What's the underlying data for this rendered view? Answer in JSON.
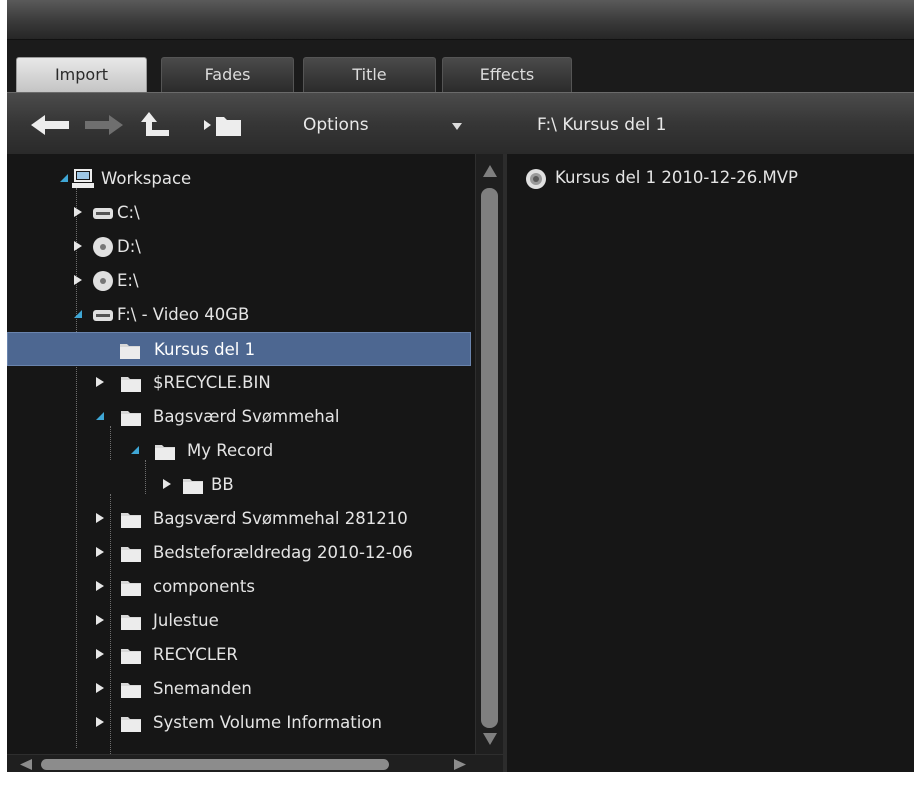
{
  "tabs": [
    {
      "label": "Import",
      "active": true
    },
    {
      "label": "Fades",
      "active": false
    },
    {
      "label": "Title",
      "active": false
    },
    {
      "label": "Effects",
      "active": false
    }
  ],
  "toolbar": {
    "back_icon": "arrow-left-icon",
    "forward_icon": "arrow-right-icon",
    "up_icon": "folder-up-icon",
    "browse_icon": "open-folder-icon",
    "options_label": "Options",
    "current_path": "F:\\ Kursus del 1"
  },
  "tree": {
    "items": [
      {
        "label": "Workspace",
        "icon": "computer-icon",
        "expander": "expanded"
      },
      {
        "label": "C:\\",
        "icon": "hard-drive-icon",
        "expander": "collapsed"
      },
      {
        "label": "D:\\",
        "icon": "disc-icon",
        "expander": "collapsed"
      },
      {
        "label": "E:\\",
        "icon": "disc-icon",
        "expander": "collapsed"
      },
      {
        "label": "F:\\ - Video 40GB",
        "icon": "hard-drive-icon",
        "expander": "expanded"
      },
      {
        "label": "Kursus del 1",
        "icon": "folder-icon",
        "expander": "none",
        "selected": true
      },
      {
        "label": "$RECYCLE.BIN",
        "icon": "folder-icon",
        "expander": "collapsed"
      },
      {
        "label": "Bagsværd Svømmehal",
        "icon": "folder-icon",
        "expander": "expanded"
      },
      {
        "label": "My Record",
        "icon": "folder-icon",
        "expander": "expanded"
      },
      {
        "label": "BB",
        "icon": "folder-icon",
        "expander": "collapsed"
      },
      {
        "label": "Bagsværd Svømmehal 281210",
        "icon": "folder-icon",
        "expander": "collapsed"
      },
      {
        "label": "Bedsteforældredag 2010-12-06",
        "icon": "folder-icon",
        "expander": "collapsed"
      },
      {
        "label": "components",
        "icon": "folder-icon",
        "expander": "collapsed"
      },
      {
        "label": "Julestue",
        "icon": "folder-icon",
        "expander": "collapsed"
      },
      {
        "label": "RECYCLER",
        "icon": "folder-icon",
        "expander": "collapsed"
      },
      {
        "label": "Snemanden",
        "icon": "folder-icon",
        "expander": "collapsed"
      },
      {
        "label": "System Volume Information",
        "icon": "folder-icon",
        "expander": "collapsed"
      }
    ]
  },
  "files": [
    {
      "label": "Kursus del 1 2010-12-26.MVP",
      "icon": "project-disc-icon"
    }
  ],
  "colors": {
    "background": "#161616",
    "selection": "#4d6791",
    "expander_accent": "#3fa7d6",
    "text": "#e4e4e4"
  }
}
